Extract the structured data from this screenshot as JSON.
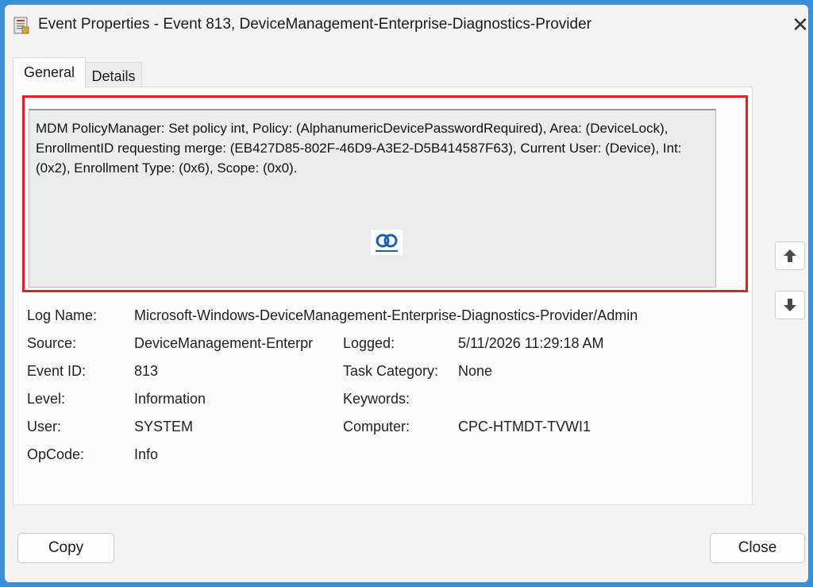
{
  "window": {
    "title": "Event Properties - Event 813, DeviceManagement-Enterprise-Diagnostics-Provider",
    "close_icon": "close-icon"
  },
  "tabs": [
    {
      "label": "General",
      "selected": true
    },
    {
      "label": "Details",
      "selected": false
    }
  ],
  "description": "MDM PolicyManager: Set policy int, Policy: (AlphanumericDevicePasswordRequired), Area: (DeviceLock), EnrollmentID requesting merge: (EB427D85-802F-46D9-A3E2-D5B414587F63), Current User: (Device), Int: (0x2), Enrollment Type: (0x6), Scope: (0x0).",
  "fields": {
    "log_name": {
      "label": "Log Name:",
      "value": "Microsoft-Windows-DeviceManagement-Enterprise-Diagnostics-Provider/Admin"
    },
    "source": {
      "label": "Source:",
      "value": "DeviceManagement-Enterpr"
    },
    "logged": {
      "label": "Logged:",
      "value": "5/11/2026 11:29:18 AM"
    },
    "event_id": {
      "label": "Event ID:",
      "value": "813"
    },
    "task_category": {
      "label": "Task Category:",
      "value": "None"
    },
    "level": {
      "label": "Level:",
      "value": "Information"
    },
    "keywords": {
      "label": "Keywords:",
      "value": ""
    },
    "user": {
      "label": "User:",
      "value": "SYSTEM"
    },
    "computer": {
      "label": "Computer:",
      "value": "CPC-HTMDT-TVWI1"
    },
    "opcode": {
      "label": "OpCode:",
      "value": "Info"
    }
  },
  "buttons": {
    "copy": "Copy",
    "close": "Close"
  },
  "colors": {
    "highlight": "#e02020",
    "frame": "#3b8fd9"
  }
}
